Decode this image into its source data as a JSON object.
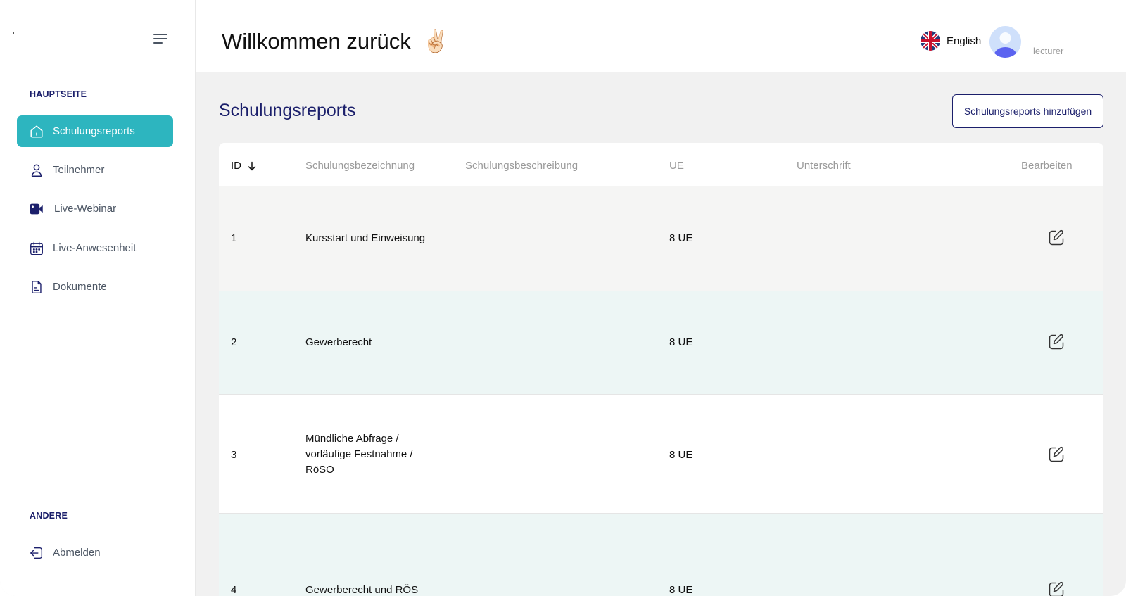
{
  "sidebar": {
    "sections": {
      "main": "HAUPTSEITE",
      "other": "ANDERE"
    },
    "items": [
      {
        "label": "Schulungsreports",
        "icon": "home-icon",
        "active": true
      },
      {
        "label": "Teilnehmer",
        "icon": "user-icon",
        "active": false
      },
      {
        "label": "Live-Webinar",
        "icon": "video-camera-icon",
        "active": false
      },
      {
        "label": "Live-Anwesenheit",
        "icon": "calendar-icon",
        "active": false
      },
      {
        "label": "Dokumente",
        "icon": "document-icon",
        "active": false
      }
    ],
    "logout": {
      "label": "Abmelden",
      "icon": "logout-icon"
    }
  },
  "header": {
    "greeting": "Willkommen zurück",
    "emoji": "✌🏻",
    "language": "English",
    "role": "lecturer"
  },
  "main": {
    "title": "Schulungsreports",
    "add_button": "Schulungsreports hinzufügen",
    "columns": [
      "ID",
      "Schulungsbezeichnung",
      "Schulungsbeschreibung",
      "UE",
      "Unterschrift",
      "Bearbeiten"
    ],
    "rows": [
      {
        "id": "1",
        "name": "Kursstart und Einweisung",
        "description": "",
        "ue": "8 UE",
        "signature": ""
      },
      {
        "id": "2",
        "name": "Gewerberecht",
        "description": "",
        "ue": "8 UE",
        "signature": ""
      },
      {
        "id": "3",
        "name_lines": [
          "Mündliche Abfrage /",
          "vorläufige Festnahme /",
          "RöSO"
        ],
        "description": "",
        "ue": "8 UE",
        "signature": ""
      },
      {
        "id": "4",
        "name": "Gewerberecht und RÖS",
        "description": "",
        "ue": "8 UE",
        "signature": ""
      }
    ]
  },
  "colors": {
    "accent": "#2db5bf",
    "navy": "#1b1f6b",
    "row_alt": "#edf6f5",
    "row_first": "#f5f5f4"
  }
}
